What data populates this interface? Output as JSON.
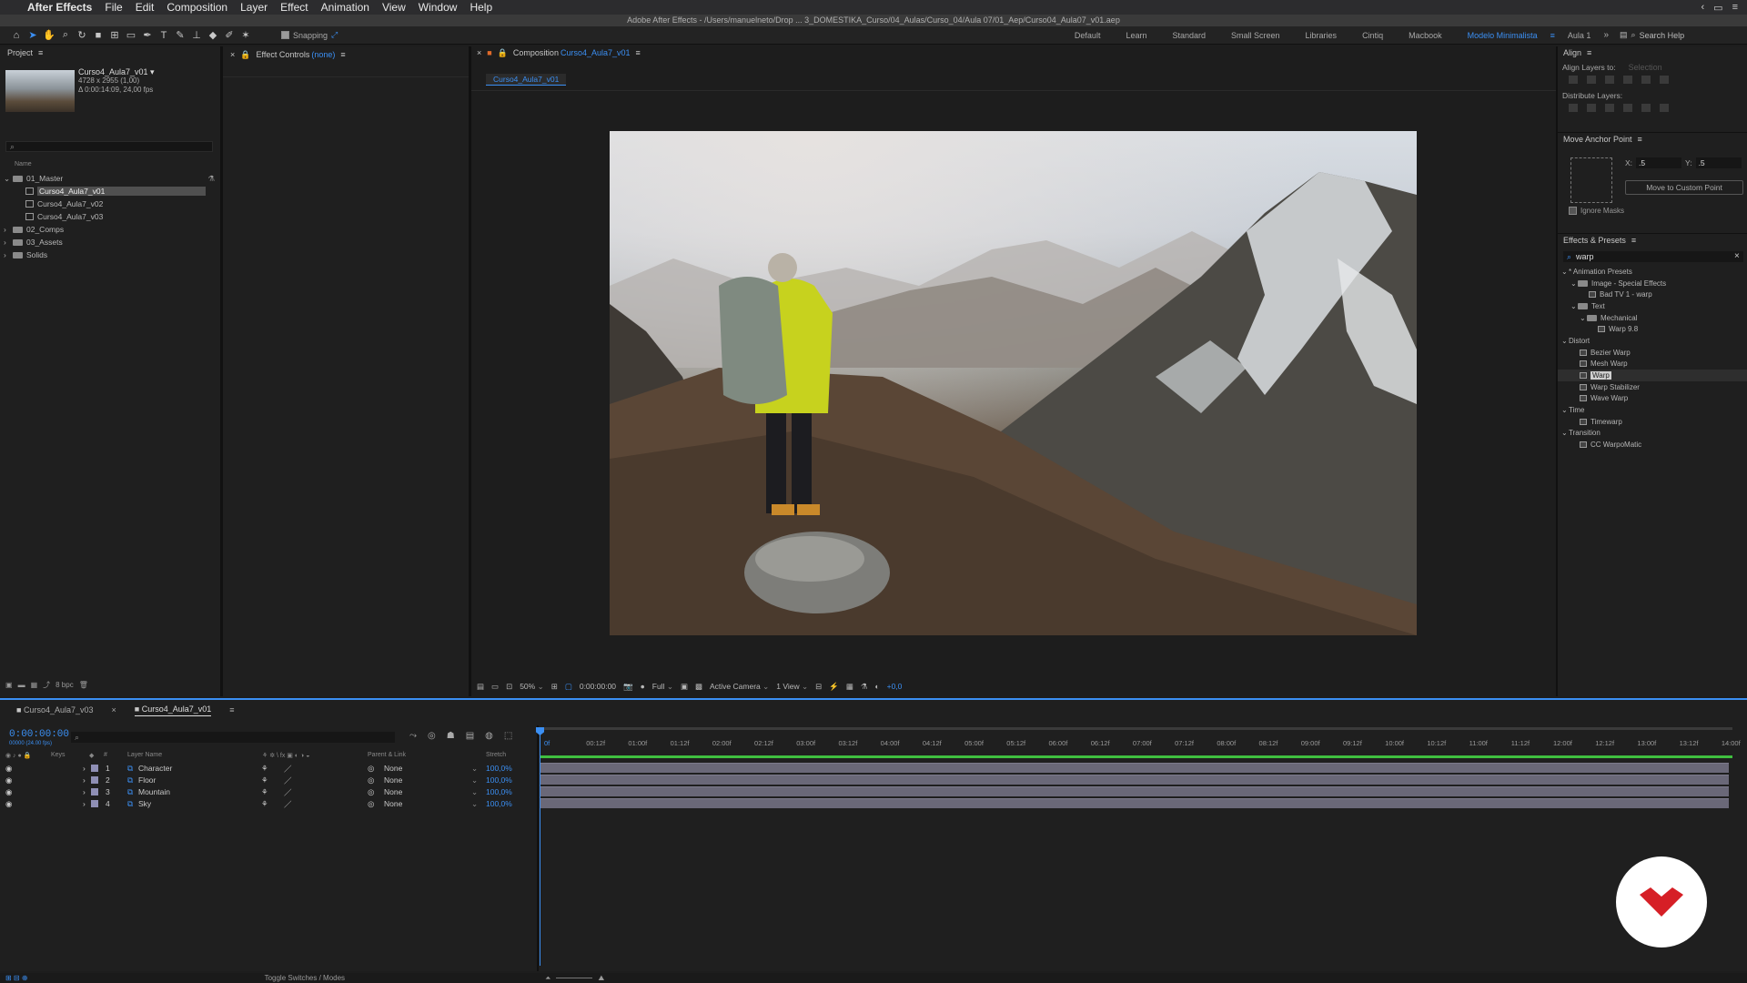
{
  "menubar": {
    "app_name": "After Effects",
    "items": [
      "File",
      "Edit",
      "Composition",
      "Layer",
      "Effect",
      "Animation",
      "View",
      "Window",
      "Help"
    ]
  },
  "titlebar": {
    "title": "Adobe After Effects - /Users/manuelneto/Drop ... 3_DOMESTIKA_Curso/04_Aulas/Curso_04/Aula 07/01_Aep/Curso04_Aula07_v01.aep"
  },
  "toolbar": {
    "snapping_label": "Snapping",
    "workspaces": [
      "Default",
      "Learn",
      "Standard",
      "Small Screen",
      "Libraries",
      "Cintiq",
      "Macbook",
      "Modelo Minimalista",
      "Aula 1"
    ],
    "active_workspace": "Modelo Minimalista",
    "search_placeholder": "Search Help"
  },
  "project": {
    "panel_title": "Project",
    "comp_name": "Curso4_Aula7_v01 ▾",
    "comp_size": "4728 x 2955 (1,00)",
    "comp_duration": "Δ 0:00:14:09, 24,00 fps",
    "column_name": "Name",
    "tree": [
      {
        "label": "01_Master",
        "type": "folder",
        "depth": 0
      },
      {
        "label": "Curso4_Aula7_v01",
        "type": "comp",
        "depth": 1,
        "selected": true
      },
      {
        "label": "Curso4_Aula7_v02",
        "type": "comp",
        "depth": 1
      },
      {
        "label": "Curso4_Aula7_v03",
        "type": "comp",
        "depth": 1
      },
      {
        "label": "02_Comps",
        "type": "folder",
        "depth": 0
      },
      {
        "label": "03_Assets",
        "type": "folder",
        "depth": 0
      },
      {
        "label": "Solids",
        "type": "folder",
        "depth": 0
      }
    ],
    "bpc": "8 bpc"
  },
  "effect_controls": {
    "title": "Effect Controls",
    "target": "(none)"
  },
  "composition": {
    "panel_label": "Composition",
    "name": "Curso4_Aula7_v01",
    "tab_label": "Curso4_Aula7_v01",
    "zoom": "50%",
    "time": "0:00:00:00",
    "resolution": "Full",
    "camera": "Active Camera",
    "view": "1 View",
    "exposure": "+0,0"
  },
  "align": {
    "title": "Align",
    "align_to_label": "Align Layers to:",
    "align_to_value": "Selection",
    "distribute_label": "Distribute Layers:"
  },
  "anchor": {
    "title": "Move Anchor Point",
    "x_label": "X:",
    "x_value": ".5",
    "y_label": "Y:",
    "y_value": ".5",
    "custom_button": "Move to Custom Point",
    "ignore_masks": "Ignore Masks"
  },
  "effects": {
    "title": "Effects & Presets",
    "search_value": "warp",
    "items": [
      {
        "label": "* Animation Presets",
        "depth": 0,
        "kind": "group"
      },
      {
        "label": "Image - Special Effects",
        "depth": 1,
        "kind": "folder"
      },
      {
        "label": "Bad TV 1 - warp",
        "depth": 2,
        "kind": "effect"
      },
      {
        "label": "Text",
        "depth": 1,
        "kind": "folder"
      },
      {
        "label": "Mechanical",
        "depth": 2,
        "kind": "folder"
      },
      {
        "label": "Warp 9.8",
        "depth": 3,
        "kind": "effect"
      },
      {
        "label": "Distort",
        "depth": 0,
        "kind": "group"
      },
      {
        "label": "Bezier Warp",
        "depth": 1,
        "kind": "effect"
      },
      {
        "label": "Mesh Warp",
        "depth": 1,
        "kind": "effect"
      },
      {
        "label": "Warp",
        "depth": 1,
        "kind": "effect",
        "selected": true
      },
      {
        "label": "Warp Stabilizer",
        "depth": 1,
        "kind": "effect"
      },
      {
        "label": "Wave Warp",
        "depth": 1,
        "kind": "effect"
      },
      {
        "label": "Time",
        "depth": 0,
        "kind": "group"
      },
      {
        "label": "Timewarp",
        "depth": 1,
        "kind": "effect"
      },
      {
        "label": "Transition",
        "depth": 0,
        "kind": "group"
      },
      {
        "label": "CC WarpoMatic",
        "depth": 1,
        "kind": "effect"
      }
    ]
  },
  "timeline": {
    "tabs": [
      "Curso4_Aula7_v03",
      "Curso4_Aula7_v01"
    ],
    "active_tab": "Curso4_Aula7_v01",
    "timecode": "0:00:00:00",
    "timecode_sub": "00000 (24.00 fps)",
    "columns": {
      "keys": "Keys",
      "num": "#",
      "layer_name": "Layer Name",
      "parent": "Parent & Link",
      "stretch": "Stretch"
    },
    "layers": [
      {
        "num": "1",
        "name": "Character",
        "parent": "None",
        "stretch": "100,0%"
      },
      {
        "num": "2",
        "name": "Floor",
        "parent": "None",
        "stretch": "100,0%"
      },
      {
        "num": "3",
        "name": "Mountain",
        "parent": "None",
        "stretch": "100,0%"
      },
      {
        "num": "4",
        "name": "Sky",
        "parent": "None",
        "stretch": "100,0%"
      }
    ],
    "ruler": [
      "0f",
      "00:12f",
      "01:00f",
      "01:12f",
      "02:00f",
      "02:12f",
      "03:00f",
      "03:12f",
      "04:00f",
      "04:12f",
      "05:00f",
      "05:12f",
      "06:00f",
      "06:12f",
      "07:00f",
      "07:12f",
      "08:00f",
      "08:12f",
      "09:00f",
      "09:12f",
      "10:00f",
      "10:12f",
      "11:00f",
      "11:12f",
      "12:00f",
      "12:12f",
      "13:00f",
      "13:12f",
      "14:00f"
    ],
    "toggle_label": "Toggle Switches / Modes"
  },
  "colors": {
    "accent": "#3b8ff3",
    "layer_label": "#8f8fb5",
    "work_area": "#3fbf3f",
    "brand": "#d61f26"
  }
}
